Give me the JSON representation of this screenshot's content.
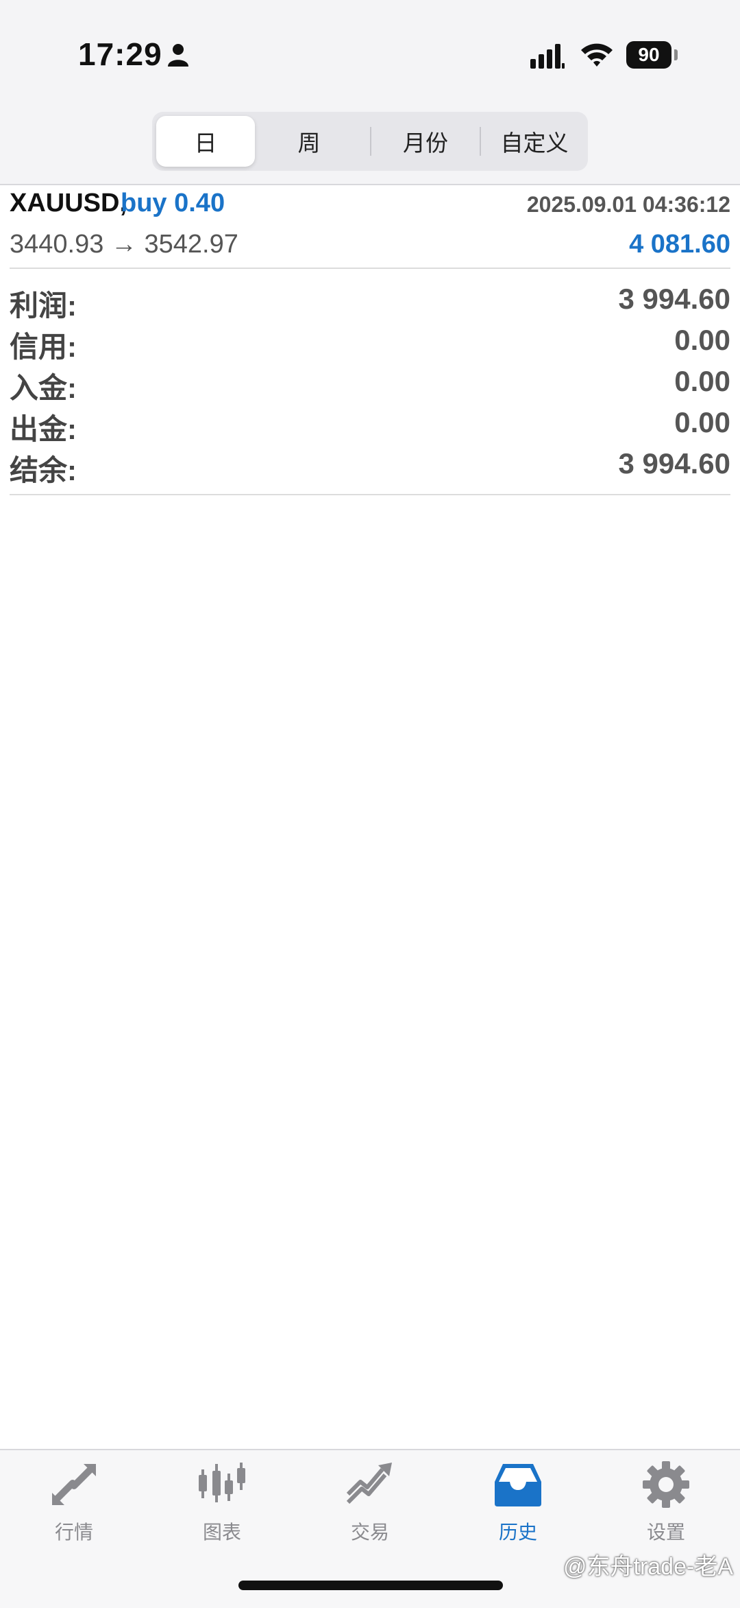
{
  "status": {
    "time": "17:29",
    "battery": "90"
  },
  "segments": [
    "日",
    "周",
    "月份",
    "自定义"
  ],
  "trade": {
    "symbol": "XAUUSD,",
    "side": "buy 0.40",
    "datetime": "2025.09.01 04:36:12",
    "prices": "3440.93 → 3542.97",
    "profit": "4 081.60"
  },
  "summary": [
    {
      "label": "利润:",
      "value": "3 994.60"
    },
    {
      "label": "信用:",
      "value": "0.00"
    },
    {
      "label": "入金:",
      "value": "0.00"
    },
    {
      "label": "出金:",
      "value": "0.00"
    },
    {
      "label": "结余:",
      "value": "3 994.60"
    }
  ],
  "tabs": [
    {
      "label": "行情",
      "icon": "quotes-arrows-icon"
    },
    {
      "label": "图表",
      "icon": "candlestick-chart-icon"
    },
    {
      "label": "交易",
      "icon": "trade-trend-icon"
    },
    {
      "label": "历史",
      "icon": "inbox-history-icon"
    },
    {
      "label": "设置",
      "icon": "gear-icon"
    }
  ],
  "active_tab": "历史",
  "watermark": "@东舟trade-老A",
  "colors": {
    "accent": "#1a73c8",
    "label_gray": "#444444",
    "value_gray": "#555555"
  }
}
